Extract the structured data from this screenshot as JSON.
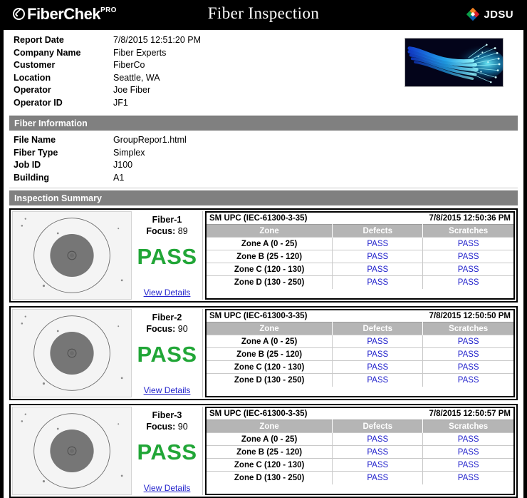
{
  "header": {
    "brand_name": "FiberChek",
    "brand_sup": "PRO",
    "brand_icon": "check-circle-icon",
    "title": "Fiber Inspection",
    "vendor": "JDSU",
    "vendor_icon": "jdsu-diamond-logo"
  },
  "report": {
    "fields": [
      {
        "label": "Report Date",
        "value": "7/8/2015 12:51:20 PM"
      },
      {
        "label": "Company Name",
        "value": "Fiber Experts"
      },
      {
        "label": "Customer",
        "value": "FiberCo"
      },
      {
        "label": "Location",
        "value": "Seattle, WA"
      },
      {
        "label": "Operator",
        "value": "Joe Fiber"
      },
      {
        "label": "Operator ID",
        "value": "JF1"
      }
    ],
    "photo_alt": "fiber-optic-cable-photo"
  },
  "fiber_information": {
    "section_title": "Fiber Information",
    "fields": [
      {
        "label": "File Name",
        "value": "GroupRepor1.html"
      },
      {
        "label": "Fiber Type",
        "value": "Simplex"
      },
      {
        "label": "Job ID",
        "value": "J100"
      },
      {
        "label": "Building",
        "value": "A1"
      }
    ]
  },
  "inspection_summary": {
    "section_title": "Inspection Summary",
    "view_details_label": "View Details",
    "focus_label": "Focus:",
    "columns": [
      "Zone",
      "Defects",
      "Scratches"
    ],
    "panels": [
      {
        "fiber_id": "Fiber-1",
        "focus": "89",
        "verdict": "PASS",
        "profile": "SM UPC (IEC-61300-3-35)",
        "timestamp": "7/8/2015 12:50:36 PM",
        "rows": [
          {
            "zone": "Zone A (0 - 25)",
            "defects": "PASS",
            "scratches": "PASS"
          },
          {
            "zone": "Zone B (25 - 120)",
            "defects": "PASS",
            "scratches": "PASS"
          },
          {
            "zone": "Zone C (120 - 130)",
            "defects": "PASS",
            "scratches": "PASS"
          },
          {
            "zone": "Zone D (130 - 250)",
            "defects": "PASS",
            "scratches": "PASS"
          }
        ]
      },
      {
        "fiber_id": "Fiber-2",
        "focus": "90",
        "verdict": "PASS",
        "profile": "SM UPC (IEC-61300-3-35)",
        "timestamp": "7/8/2015 12:50:50 PM",
        "rows": [
          {
            "zone": "Zone A (0 - 25)",
            "defects": "PASS",
            "scratches": "PASS"
          },
          {
            "zone": "Zone B (25 - 120)",
            "defects": "PASS",
            "scratches": "PASS"
          },
          {
            "zone": "Zone C (120 - 130)",
            "defects": "PASS",
            "scratches": "PASS"
          },
          {
            "zone": "Zone D (130 - 250)",
            "defects": "PASS",
            "scratches": "PASS"
          }
        ]
      },
      {
        "fiber_id": "Fiber-3",
        "focus": "90",
        "verdict": "PASS",
        "profile": "SM UPC (IEC-61300-3-35)",
        "timestamp": "7/8/2015 12:50:57 PM",
        "rows": [
          {
            "zone": "Zone A (0 - 25)",
            "defects": "PASS",
            "scratches": "PASS"
          },
          {
            "zone": "Zone B (25 - 120)",
            "defects": "PASS",
            "scratches": "PASS"
          },
          {
            "zone": "Zone C (120 - 130)",
            "defects": "PASS",
            "scratches": "PASS"
          },
          {
            "zone": "Zone D (130 - 250)",
            "defects": "PASS",
            "scratches": "PASS"
          }
        ]
      }
    ]
  },
  "colors": {
    "pass_green": "#21a637",
    "link_blue": "#2222cc",
    "section_gray": "#808080",
    "table_header_gray": "#b5b5b5",
    "titlebar_black": "#000000"
  }
}
